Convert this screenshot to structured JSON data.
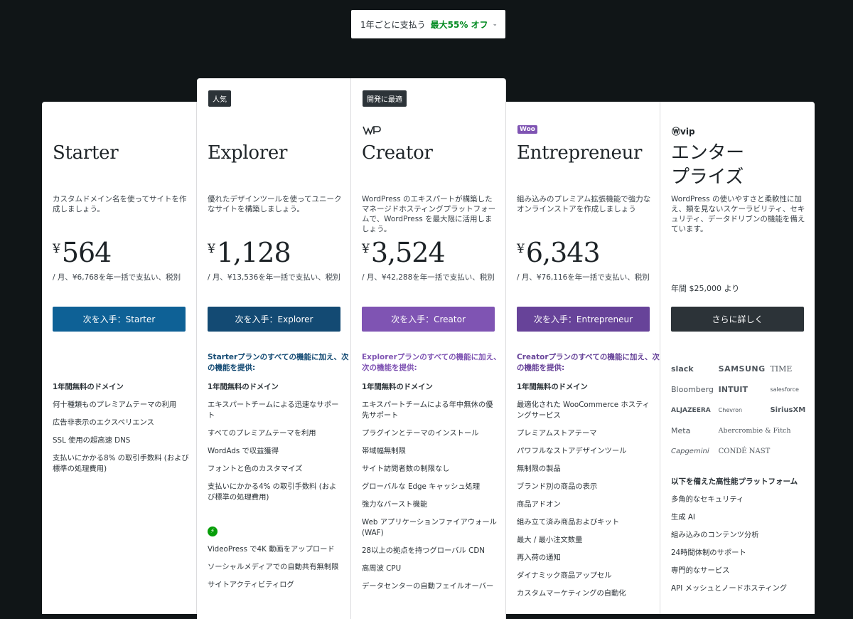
{
  "billing": {
    "label": "1年ごとに支払う",
    "discount": "最大55% オフ",
    "chevron": "›"
  },
  "colors": {
    "starter": "#0e6196",
    "explorer": "#134a73",
    "creator": "#7f54b3",
    "entrepreneur": "#674399",
    "enterprise": "#2c3338"
  },
  "plans": [
    {
      "name": "Starter",
      "desc": "カスタムドメイン名を使ってサイトを作成しましょう。",
      "currency": "¥",
      "price": "564",
      "note": "/ 月、¥6,768を年一括で支払い、税別",
      "cta": "次を入手：Starter",
      "features": [
        "1年間無料のドメイン",
        "何十種類ものプレミアムテーマの利用",
        "広告非表示のエクスペリエンス",
        "SSL 使用の超高速 DNS",
        "支払いにかかる8% の取引手数料 (および標準の処理費用)"
      ]
    },
    {
      "name": "Explorer",
      "badge": "人気",
      "desc": "優れたデザインツールを使ってユニークなサイトを構築しましょう。",
      "currency": "¥",
      "price": "1,128",
      "note": "/ 月、¥13,536を年一括で支払い、税別",
      "cta": "次を入手：Explorer",
      "intro": "Starterプランのすべての機能に加え、次の機能を提供:",
      "features": [
        "1年間無料のドメイン",
        "エキスパートチームによる迅速なサポート",
        "すべてのプレミアムテーマを利用",
        "WordAds で収益獲得",
        "フォントと色のカスタマイズ",
        "支払いにかかる4% の取引手数料 (および標準の処理費用)"
      ],
      "extra": [
        "VideoPress で4K 動画をアップロード",
        "ソーシャルメディアでの自動共有無制限",
        "サイトアクティビティログ"
      ]
    },
    {
      "name": "Creator",
      "badge": "開発に最適",
      "logo": "WP",
      "desc": "WordPress のエキスパートが構築したマネージドホスティングプラットフォームで、WordPress を最大限に活用しましょう。",
      "currency": "¥",
      "price": "3,524",
      "note": "/ 月、¥42,288を年一括で支払い、税別",
      "cta": "次を入手：Creator",
      "intro": "Explorerプランのすべての機能に加え、次の機能を提供:",
      "features": [
        "1年間無料のドメイン",
        "エキスパートチームによる年中無休の優先サポート",
        "プラグインとテーマのインストール",
        "帯域幅無制限",
        "サイト訪問者数の制限なし",
        "グローバルな Edge キャッシュ処理",
        "強力なバースト機能",
        "Web アプリケーションファイアウォール (WAF)",
        "28以上の拠点を持つグローバル CDN",
        "高周波 CPU",
        "データセンターの自動フェイルオーバー"
      ]
    },
    {
      "name": "Entrepreneur",
      "logo": "Woo",
      "desc": "組み込みのプレミアム拡張機能で強力なオンラインストアを作成しましょう",
      "currency": "¥",
      "price": "6,343",
      "note": "/ 月、¥76,116を年一括で支払い、税別",
      "cta": "次を入手：Entrepreneur",
      "intro": "Creatorプランのすべての機能に加え、次の機能を提供:",
      "features": [
        "1年間無料のドメイン",
        "最適化された WooCommerce ホスティングサービス",
        "プレミアムストアテーマ",
        "パワフルなストアデザインツール",
        "無制限の製品",
        "ブランド別の商品の表示",
        "商品アドオン",
        "組み立て済み商品およびキット",
        "最大 / 最小注文数量",
        "再入荷の通知",
        "ダイナミック商品アップセル",
        "カスタムマーケティングの自動化"
      ]
    },
    {
      "name": "エンター\nプライズ",
      "logo": "vip",
      "desc": "WordPress の使いやすさと柔軟性に加え、類を見ないスケーラビリティ、セキュリティ、データドリブンの機能を備えています。",
      "note": "年間 $25,000 より",
      "cta": "さらに詳しく",
      "logos": [
        "slack",
        "SAMSUNG",
        "TIME",
        "Bloomberg",
        "INTUIT",
        "salesforce",
        "ALJAZEERA",
        "Chevron",
        "SiriusXM",
        "Meta",
        "Abercrombie & Fitch",
        "Capgemini",
        "CONDÉ NAST"
      ],
      "intro": "以下を備えた高性能プラットフォーム",
      "features": [
        "多角的なセキュリティ",
        "生成 AI",
        "組み込みのコンテンツ分析",
        "24時間体制のサポート",
        "専門的なサービス",
        "API メッシュとノードホスティング"
      ]
    }
  ]
}
